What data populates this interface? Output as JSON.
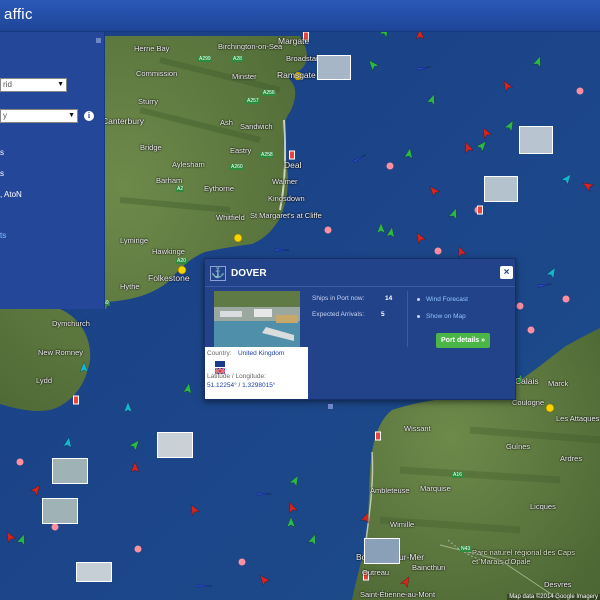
{
  "app": {
    "title_fragment": "affic"
  },
  "left_panel": {
    "select_1": "rid",
    "select_2": "y",
    "items": [
      "s",
      "s",
      ", AtoN"
    ],
    "link": "ts"
  },
  "map": {
    "towns": [
      {
        "name": "Margate",
        "big": true
      },
      {
        "name": "Herne Bay"
      },
      {
        "name": "Birchington-on-Sea"
      },
      {
        "name": "Broadstairs"
      },
      {
        "name": "Commission"
      },
      {
        "name": "Minster"
      },
      {
        "name": "Ramsgate",
        "big": true
      },
      {
        "name": "Sturry"
      },
      {
        "name": "Canterbury",
        "big": true
      },
      {
        "name": "Ash"
      },
      {
        "name": "Sandwich"
      },
      {
        "name": "Bridge"
      },
      {
        "name": "Aylesham"
      },
      {
        "name": "Eastry"
      },
      {
        "name": "Barham"
      },
      {
        "name": "Walmer"
      },
      {
        "name": "Deal",
        "big": true
      },
      {
        "name": "Eythorne"
      },
      {
        "name": "Kingsdown"
      },
      {
        "name": "Whitfield"
      },
      {
        "name": "St Margaret's at Cliffe"
      },
      {
        "name": "Lyminge"
      },
      {
        "name": "Hawkinge"
      },
      {
        "name": "Folkestone",
        "big": true
      },
      {
        "name": "Hythe"
      },
      {
        "name": "Dymchurch"
      },
      {
        "name": "New Romney"
      },
      {
        "name": "Lydd"
      },
      {
        "name": "Calais",
        "big": true
      },
      {
        "name": "Marck"
      },
      {
        "name": "Coulogne"
      },
      {
        "name": "Les Attaques"
      },
      {
        "name": "Wissant"
      },
      {
        "name": "Guînes"
      },
      {
        "name": "Ardres"
      },
      {
        "name": "Ambleteuse"
      },
      {
        "name": "Marquise"
      },
      {
        "name": "Licques"
      },
      {
        "name": "Wimille"
      },
      {
        "name": "Boulogne-sur-Mer",
        "big": true
      },
      {
        "name": "Outreau"
      },
      {
        "name": "Baincthun"
      },
      {
        "name": "Desvres"
      },
      {
        "name": "Saint-Étienne-au-Mont"
      },
      {
        "name": "Parc naturel régional des Caps et Marais d'Opale"
      }
    ],
    "roads": [
      "A28",
      "A299",
      "A256",
      "A257",
      "A258",
      "A2",
      "A20",
      "A260",
      "A259",
      "N43",
      "A16"
    ],
    "copyright": "Map data ©2014 Google Imagery"
  },
  "popup": {
    "port_name": "DOVER",
    "country_label": "Country:",
    "country": "United Kingdom",
    "latlon_label": "Latitude / Longitude:",
    "latlon": "51.12254° / 1.3298015°",
    "ships_in_port_label": "Ships in Port now:",
    "ships_in_port": "14",
    "expected_arrivals_label": "Expected Arrivals:",
    "expected_arrivals": "5",
    "wind_forecast": "Wind Forecast",
    "show_on_map": "Show on Map",
    "port_details": "Port details »",
    "close": "×"
  },
  "colors": {
    "sea": "#1f4f8e",
    "land": "#5f7a3f",
    "panel": "#25479a",
    "ship_cargo": "#2db84a",
    "ship_tanker": "#d9231e",
    "ship_fast": "#18b5d0",
    "ship_other": "#2a47d8",
    "buoy": "#ff8fa0",
    "port_button": "#4bb547"
  }
}
